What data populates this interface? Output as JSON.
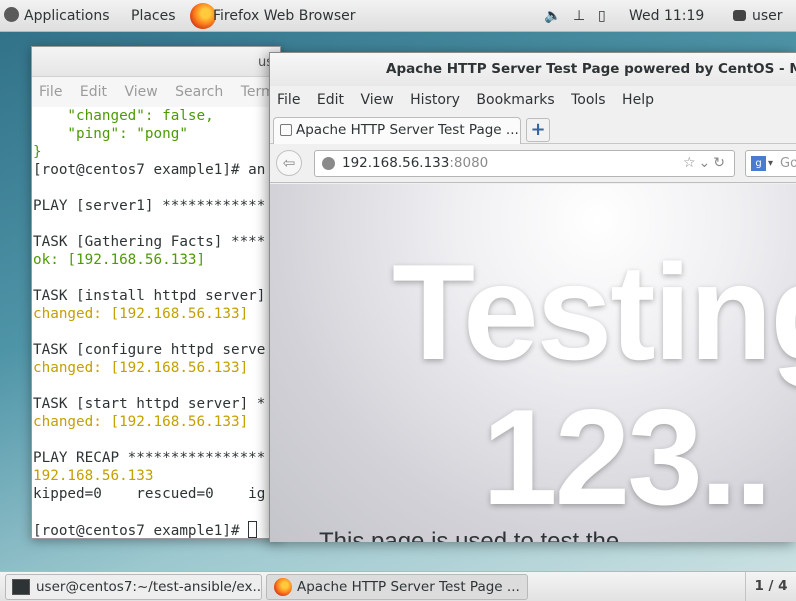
{
  "top_panel": {
    "applications": "Applications",
    "places": "Places",
    "active_app": "Firefox Web Browser",
    "clock": "Wed 11:19",
    "user": "user"
  },
  "terminal": {
    "title": "us",
    "menu": [
      "File",
      "Edit",
      "View",
      "Search",
      "Termin"
    ],
    "lines": [
      {
        "text": "    \"changed\": false,",
        "style": "t-gr"
      },
      {
        "text": "    \"ping\": \"pong\"",
        "style": "t-gr"
      },
      {
        "text": "}",
        "style": "t-gr"
      },
      {
        "text": "[root@centos7 example1]# an",
        "style": ""
      },
      {
        "text": "",
        "style": ""
      },
      {
        "text": "PLAY [server1] ************",
        "style": ""
      },
      {
        "text": "",
        "style": ""
      },
      {
        "text": "TASK [Gathering Facts] ****",
        "style": ""
      },
      {
        "text": "ok: [192.168.56.133]",
        "style": "t-ok"
      },
      {
        "text": "",
        "style": ""
      },
      {
        "text": "TASK [install httpd server]",
        "style": ""
      },
      {
        "text": "changed: [192.168.56.133]",
        "style": "t-ch"
      },
      {
        "text": "",
        "style": ""
      },
      {
        "text": "TASK [configure httpd serve",
        "style": ""
      },
      {
        "text": "changed: [192.168.56.133]",
        "style": "t-ch"
      },
      {
        "text": "",
        "style": ""
      },
      {
        "text": "TASK [start httpd server] *",
        "style": ""
      },
      {
        "text": "changed: [192.168.56.133]",
        "style": "t-ch"
      },
      {
        "text": "",
        "style": ""
      },
      {
        "text": "PLAY RECAP ****************",
        "style": ""
      },
      {
        "text": "192.168.56.133",
        "style": "t-ch"
      },
      {
        "text": "kipped=0    rescued=0    ig",
        "style": ""
      },
      {
        "text": "",
        "style": ""
      }
    ],
    "prompt": "[root@centos7 example1]# "
  },
  "firefox": {
    "window_title": "Apache HTTP Server Test Page powered by CentOS - Mozi",
    "menu": [
      "File",
      "Edit",
      "View",
      "History",
      "Bookmarks",
      "Tools",
      "Help"
    ],
    "tab_label": "Apache HTTP Server Test Page ...",
    "url_host": "192.168.56.133",
    "url_port": ":8080",
    "search_placeholder": "Go",
    "content_heading_1": "Testing",
    "content_heading_2": "123..",
    "content_partial_text": "This page is used to test the"
  },
  "taskbar": {
    "task_terminal": "user@centos7:~/test-ansible/ex...",
    "task_firefox": "Apache HTTP Server Test Page ...",
    "workspace": "1 / 4"
  }
}
